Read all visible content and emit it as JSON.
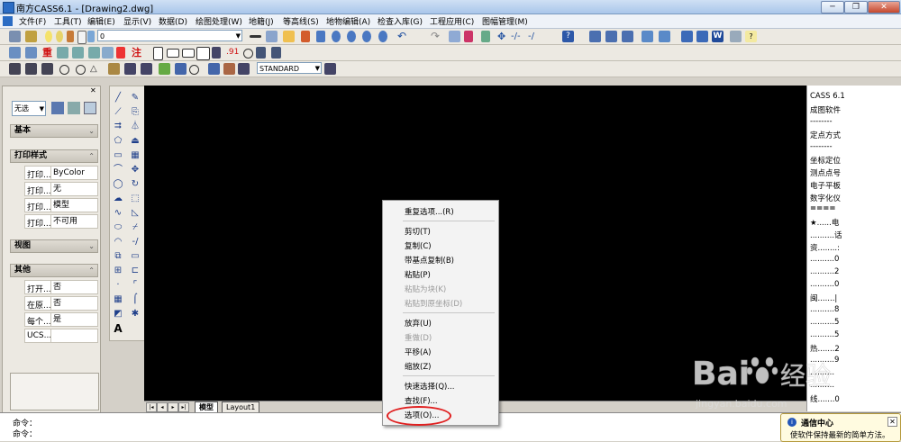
{
  "window": {
    "title": "南方CASS6.1 - [Drawing2.dwg]",
    "minimize": "─",
    "restore": "❐",
    "close": "✕"
  },
  "menu": [
    "文件(F)",
    "工具(T)",
    "编辑(E)",
    "显示(V)",
    "数据(D)",
    "绘图处理(W)",
    "地籍(J)",
    "等高线(S)",
    "地物编辑(A)",
    "检查入库(G)",
    "工程应用(C)",
    "图幅管理(M)"
  ],
  "toolbar": {
    "layer_value": "0",
    "textstyle_value": "STANDARD",
    "text_zhong": "重",
    "text_zhu": "注",
    "text_91": ".91"
  },
  "left_palette": {
    "filter_value": "无选",
    "sections": {
      "basic": "基本",
      "print_style": "打印样式",
      "view": "视图",
      "other": "其他"
    },
    "print_rows": [
      {
        "k": "打印...",
        "v": "ByColor"
      },
      {
        "k": "打印...",
        "v": "无"
      },
      {
        "k": "打印...",
        "v": "模型"
      },
      {
        "k": "打印...",
        "v": "不可用"
      }
    ],
    "other_rows": [
      {
        "k": "打开...",
        "v": "否"
      },
      {
        "k": "在原...",
        "v": "否"
      },
      {
        "k": "每个...",
        "v": "是"
      },
      {
        "k": "UCS...",
        "v": ""
      }
    ]
  },
  "draw_text_tool": "A",
  "tabs": {
    "model": "模型",
    "layout1": "Layout1"
  },
  "right_panel": [
    "CASS 6.1",
    "成图软件",
    "--------",
    "定点方式",
    "--------",
    "坐标定位",
    "测点点号",
    "电子平板",
    "数字化仪",
    "====",
    "★......电",
    "..........话",
    "资........:",
    "..........0",
    "..........2",
    "..........0",
    "闽.......|",
    "..........8",
    "..........5",
    "..........5",
    "热.......2",
    "..........9",
    "..........",
    "..........",
    "线.......0"
  ],
  "context_menu": {
    "items": [
      {
        "label": "重复选项...(R)",
        "disabled": false
      },
      {
        "label": "剪切(T)",
        "disabled": false
      },
      {
        "label": "复制(C)",
        "disabled": false
      },
      {
        "label": "带基点复制(B)",
        "disabled": false
      },
      {
        "label": "粘贴(P)",
        "disabled": false
      },
      {
        "label": "粘贴为块(K)",
        "disabled": true
      },
      {
        "label": "粘贴到原坐标(D)",
        "disabled": true
      },
      {
        "label": "放弃(U)",
        "disabled": false
      },
      {
        "label": "重做(D)",
        "disabled": true
      },
      {
        "label": "平移(A)",
        "disabled": false
      },
      {
        "label": "缩放(Z)",
        "disabled": false
      },
      {
        "label": "快速选择(Q)...",
        "disabled": false
      },
      {
        "label": "查找(F)...",
        "disabled": false
      },
      {
        "label": "选项(O)...",
        "disabled": false
      }
    ]
  },
  "command_line": {
    "line1": "命令：",
    "line2": "命令："
  },
  "notification": {
    "title": "通信中心",
    "body": "使软件保持最新的简单方法。",
    "close": "✕"
  },
  "watermark": {
    "brand": "Bai",
    "brand2": "经验",
    "url": "jingyan.baidu.com"
  },
  "colors": {
    "canvas": "#000000",
    "highlight_circle": "#e02020",
    "toolbar": "#ece9e2"
  }
}
